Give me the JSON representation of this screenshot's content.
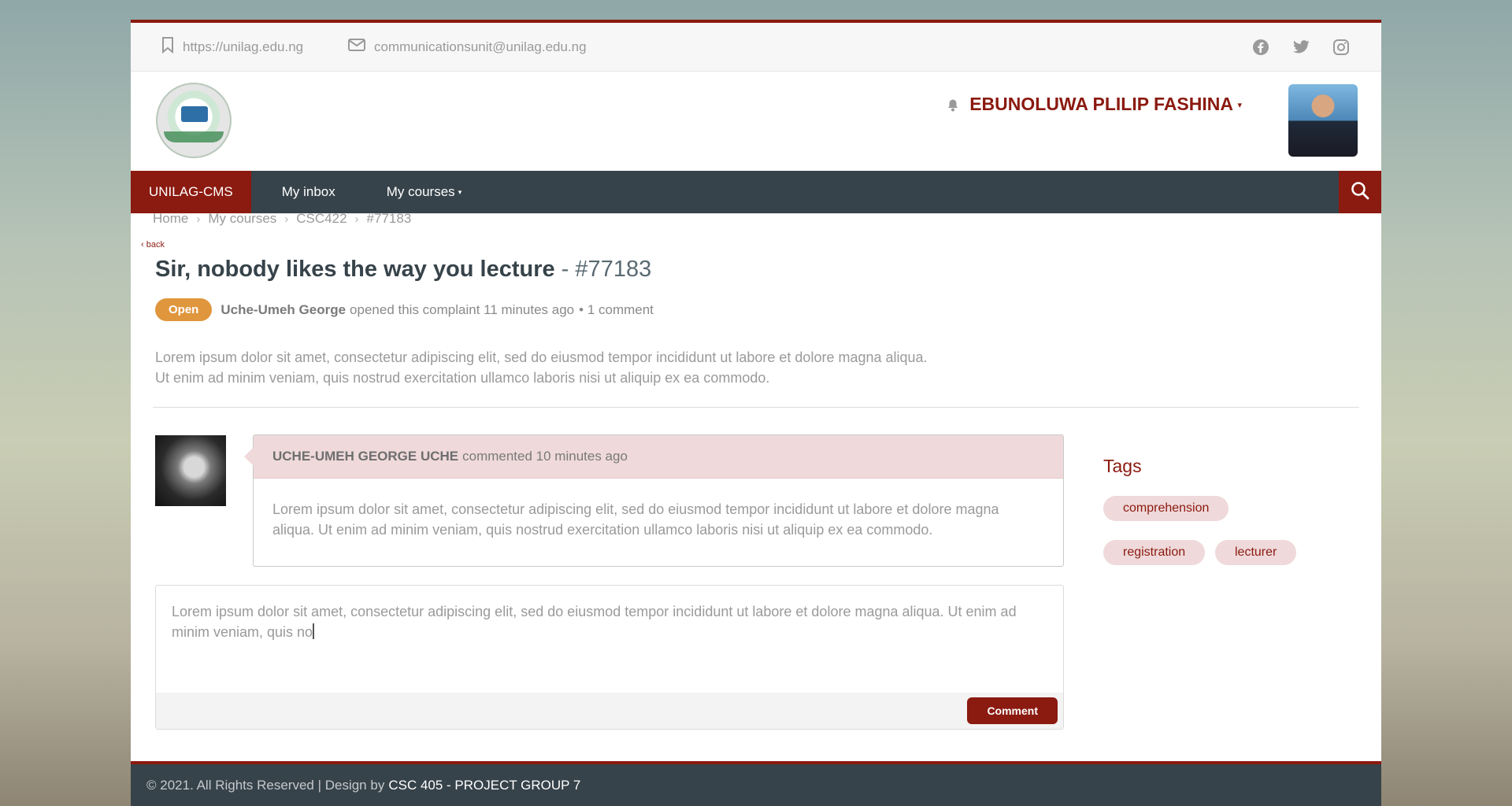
{
  "topbar": {
    "website": "https://unilag.edu.ng",
    "email": "communicationsunit@unilag.edu.ng",
    "social": [
      "facebook-icon",
      "twitter-icon",
      "instagram-icon"
    ]
  },
  "header": {
    "user_name": "EBUNOLUWA PLILIP FASHINA",
    "caret": "▾"
  },
  "nav": {
    "brand": "UNILAG-CMS",
    "inbox": "My inbox",
    "courses": "My courses",
    "caret": "▾"
  },
  "breadcrumb": [
    "Home",
    "My courses",
    "CSC422",
    "#77183"
  ],
  "back_label": "back",
  "complaint": {
    "title": "Sir, nobody likes the way you lecture",
    "number": "- #77183",
    "status": "Open",
    "author": "Uche-Umeh George",
    "opened_text": "opened this complaint 11 minutes ago",
    "comment_count": "• 1 comment",
    "description": "Lorem ipsum dolor sit amet, consectetur adipiscing elit, sed do eiusmod tempor incididunt ut labore et dolore magna aliqua. Ut enim ad minim veniam, quis nostrud exercitation ullamco laboris nisi ut aliquip ex ea commodo."
  },
  "comment": {
    "author": "UCHE-UMEH GEORGE UCHE",
    "time_text": "commented 10 minutes ago",
    "body": "Lorem ipsum dolor sit amet, consectetur adipiscing elit, sed do eiusmod tempor incididunt ut labore et dolore magna aliqua. Ut enim ad minim veniam, quis nostrud exercitation ullamco laboris nisi ut aliquip ex ea commodo."
  },
  "reply": {
    "value": "Lorem ipsum dolor sit amet, consectetur adipiscing elit, sed do eiusmod tempor incididunt ut labore et dolore magna aliqua. Ut enim ad minim veniam, quis no",
    "button": "Comment"
  },
  "tags": {
    "title": "Tags",
    "items": [
      "comprehension",
      "registration",
      "lecturer"
    ]
  },
  "footer": {
    "text": "© 2021. All Rights Reserved | Design by",
    "credit": "CSC 405 - PROJECT GROUP 7"
  },
  "colors": {
    "brand": "#8b1a10",
    "nav": "#37434a",
    "badge": "#e0963c",
    "tag_bg": "#efd9da"
  }
}
